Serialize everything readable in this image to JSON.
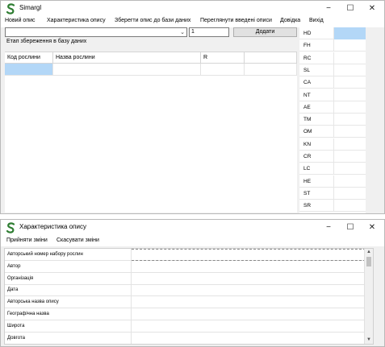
{
  "main_window": {
    "title": "Simargl",
    "menu": [
      "Новий опис",
      "Характеристика опису",
      "Зберегти опис до бази даних",
      "Переглянути введені описи",
      "Довідка",
      "Вихід"
    ],
    "quantity_value": "1",
    "add_button": "Додати",
    "stage_label": "Етап збереження в базу даних",
    "table_headers": [
      "Код рослини",
      "Назва рослини",
      "R",
      ""
    ],
    "codes": [
      "HD",
      "FH",
      "RC",
      "SL",
      "CA",
      "NT",
      "AE",
      "TM",
      "OM",
      "KN",
      "CR",
      "LC",
      "HE",
      "ST",
      "SR"
    ]
  },
  "desc_window": {
    "title": "Характеристика опису",
    "accept_label": "Прийняти зміни",
    "cancel_label": "Скасувати зміни",
    "fields": [
      "Авторський номер набору рослин",
      "Автор",
      "Організація",
      "Дата",
      "Авторська назва опису",
      "Географічна назва",
      "Широта",
      "Довгота"
    ]
  },
  "window_controls": {
    "minimize": "−",
    "maximize": "☐",
    "close": "✕"
  },
  "icons": {
    "logo": "simargl-logo-icon",
    "dropdown": "chevron-down-icon"
  },
  "colors": {
    "selection": "#b3d7f7",
    "logo_green": "#2e7d32"
  }
}
